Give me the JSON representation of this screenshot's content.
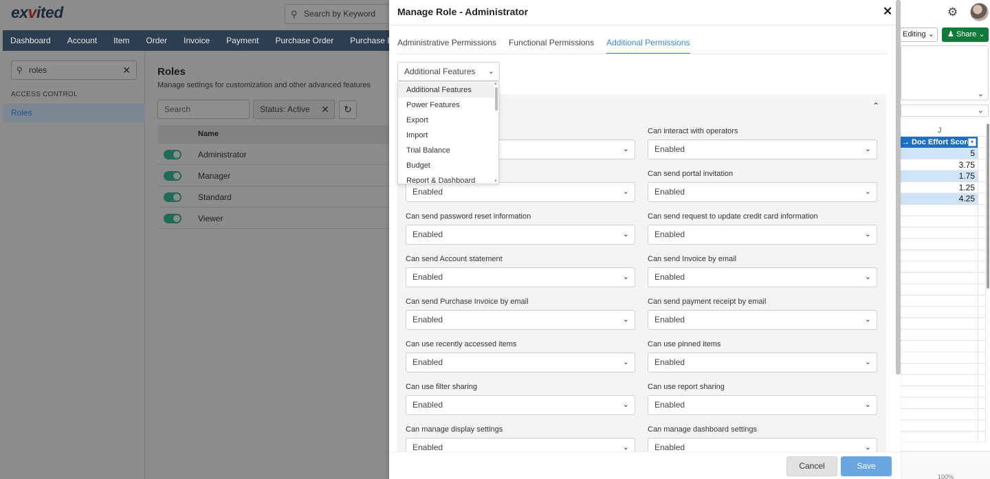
{
  "app": {
    "logo_text": "ex",
    "logo_accent": "v",
    "logo_rest": "ited",
    "keyword_search_placeholder": "Search by Keyword",
    "nav": [
      "Dashboard",
      "Account",
      "Item",
      "Order",
      "Invoice",
      "Payment",
      "Purchase Order",
      "Purchase Invoice"
    ],
    "sidebar": {
      "search_value": "roles",
      "section_label": "ACCESS CONTROL",
      "active_item": "Roles"
    },
    "main": {
      "title": "Roles",
      "subtitle": "Manage settings for customization and other advanced features",
      "search_placeholder": "Search",
      "status_filter": "Status: Active",
      "column_name": "Name",
      "rows": [
        {
          "name": "Administrator",
          "enabled": true
        },
        {
          "name": "Manager",
          "enabled": true
        },
        {
          "name": "Standard",
          "enabled": true
        },
        {
          "name": "Viewer",
          "enabled": true
        }
      ]
    }
  },
  "spreadsheet": {
    "editing_label": "Editing",
    "share_label": "Share",
    "column_letter": "J",
    "header_cell": "→ Doc Effort Score",
    "values": [
      "5",
      "3.75",
      "1.75",
      "1.25",
      "4.25"
    ],
    "zoom": "100%"
  },
  "modal": {
    "title": "Manage Role - Administrator",
    "tabs": [
      {
        "label": "Administrative Permissions",
        "active": false
      },
      {
        "label": "Functional Permissions",
        "active": false
      },
      {
        "label": "Additional Permissions",
        "active": true
      }
    ],
    "feature_select": "Additional Features",
    "dropdown_options": [
      "Additional Features",
      "Power Features",
      "Export",
      "Import",
      "Trial Balance",
      "Budget",
      "Report & Dashboard"
    ],
    "permissions_left": [
      {
        "label": "",
        "value": ""
      },
      {
        "label": "",
        "value": "Enabled"
      },
      {
        "label": "Can send password reset information",
        "value": "Enabled"
      },
      {
        "label": "Can send Account statement",
        "value": "Enabled"
      },
      {
        "label": "Can send Purchase Invoice by email",
        "value": "Enabled"
      },
      {
        "label": "Can use recently accessed items",
        "value": "Enabled"
      },
      {
        "label": "Can use filter sharing",
        "value": "Enabled"
      },
      {
        "label": "Can manage display settings",
        "value": "Enabled"
      }
    ],
    "permissions_right": [
      {
        "label": "Can interact with operators",
        "value": "Enabled"
      },
      {
        "label": "Can send portal invitation",
        "value": "Enabled"
      },
      {
        "label": "Can send request to update credit card information",
        "value": "Enabled"
      },
      {
        "label": "Can send Invoice by email",
        "value": "Enabled"
      },
      {
        "label": "Can send payment receipt by email",
        "value": "Enabled"
      },
      {
        "label": "Can use pinned items",
        "value": "Enabled"
      },
      {
        "label": "Can use report sharing",
        "value": "Enabled"
      },
      {
        "label": "Can manage dashboard settings",
        "value": "Enabled"
      }
    ],
    "cancel_label": "Cancel",
    "save_label": "Save"
  }
}
